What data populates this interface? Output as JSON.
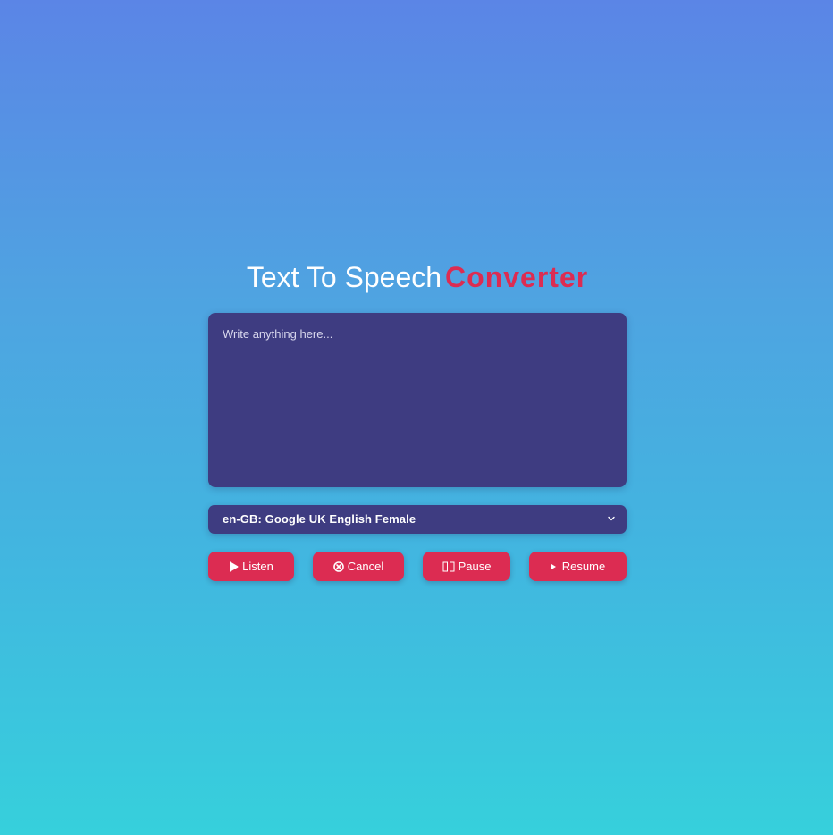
{
  "title": {
    "prefix": "Text To Speech",
    "accent": "Converter",
    "accent_color": "#dc2c52"
  },
  "textarea": {
    "placeholder": "Write anything here...",
    "value": ""
  },
  "voice_select": {
    "selected": "en-GB: Google UK English Female",
    "icon": "chevron-down-icon"
  },
  "buttons": {
    "listen": {
      "label": "Listen",
      "icon": "play-icon"
    },
    "cancel": {
      "label": "Cancel",
      "icon": "cancel-circle-icon"
    },
    "pause": {
      "label": "Pause",
      "icon": "pause-icon"
    },
    "resume": {
      "label": "Resume",
      "icon": "resume-icon"
    }
  },
  "colors": {
    "panel": "#3e3c81",
    "button": "#dc2c52",
    "background_top": "#5b85e6",
    "background_bottom": "#36d0dc"
  }
}
